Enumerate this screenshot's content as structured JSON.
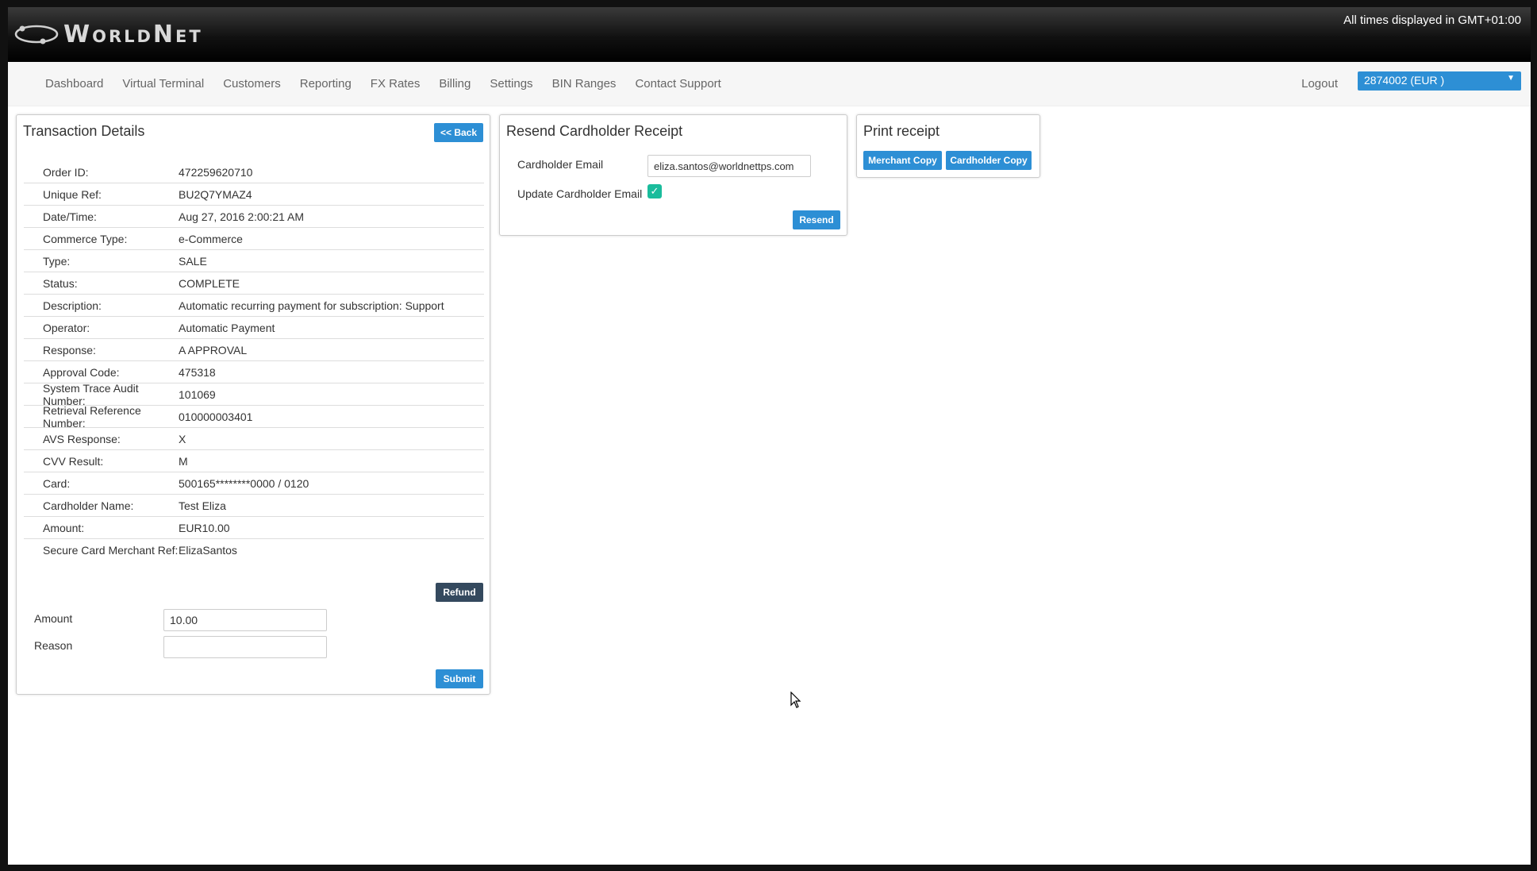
{
  "header": {
    "logo_text": "WorldNet",
    "timezone_notice": "All times displayed in GMT+01:00"
  },
  "nav": {
    "items": [
      "Dashboard",
      "Virtual Terminal",
      "Customers",
      "Reporting",
      "FX Rates",
      "Billing",
      "Settings",
      "BIN Ranges",
      "Contact Support"
    ],
    "logout": "Logout",
    "merchant_account": "2874002 (EUR )"
  },
  "transaction": {
    "title": "Transaction Details",
    "back_button": "<< Back",
    "fields": [
      {
        "label": "Order ID:",
        "value": "472259620710"
      },
      {
        "label": "Unique Ref:",
        "value": "BU2Q7YMAZ4"
      },
      {
        "label": "Date/Time:",
        "value": "Aug 27, 2016 2:00:21 AM"
      },
      {
        "label": "Commerce Type:",
        "value": "e-Commerce"
      },
      {
        "label": "Type:",
        "value": "SALE"
      },
      {
        "label": "Status:",
        "value": "COMPLETE"
      },
      {
        "label": "Description:",
        "value": "Automatic recurring payment for subscription: Support"
      },
      {
        "label": "Operator:",
        "value": "Automatic Payment"
      },
      {
        "label": "Response:",
        "value": "A APPROVAL"
      },
      {
        "label": "Approval Code:",
        "value": "475318"
      },
      {
        "label": "System Trace Audit Number:",
        "value": "101069"
      },
      {
        "label": "Retrieval Reference Number:",
        "value": "010000003401"
      },
      {
        "label": "AVS Response:",
        "value": "X"
      },
      {
        "label": "CVV Result:",
        "value": "M"
      },
      {
        "label": "Card:",
        "value": "500165********0000 / 0120"
      },
      {
        "label": "Cardholder Name:",
        "value": "Test Eliza"
      },
      {
        "label": "Amount:",
        "value": "EUR10.00"
      },
      {
        "label": "Secure Card Merchant Ref:",
        "value": "ElizaSantos"
      }
    ],
    "refund_button": "Refund",
    "refund_form": {
      "amount_label": "Amount",
      "amount_value": "10.00",
      "reason_label": "Reason",
      "reason_value": "",
      "submit_button": "Submit"
    }
  },
  "resend": {
    "title": "Resend Cardholder Receipt",
    "email_label": "Cardholder Email",
    "email_value": "eliza.santos@worldnettps.com",
    "update_label": "Update Cardholder Email",
    "update_checked": true,
    "resend_button": "Resend"
  },
  "print": {
    "title": "Print receipt",
    "merchant_copy": "Merchant Copy",
    "cardholder_copy": "Cardholder Copy"
  },
  "colors": {
    "accent": "#2d8fd5",
    "dark_button": "#34495e",
    "checkbox": "#1abc9c"
  }
}
